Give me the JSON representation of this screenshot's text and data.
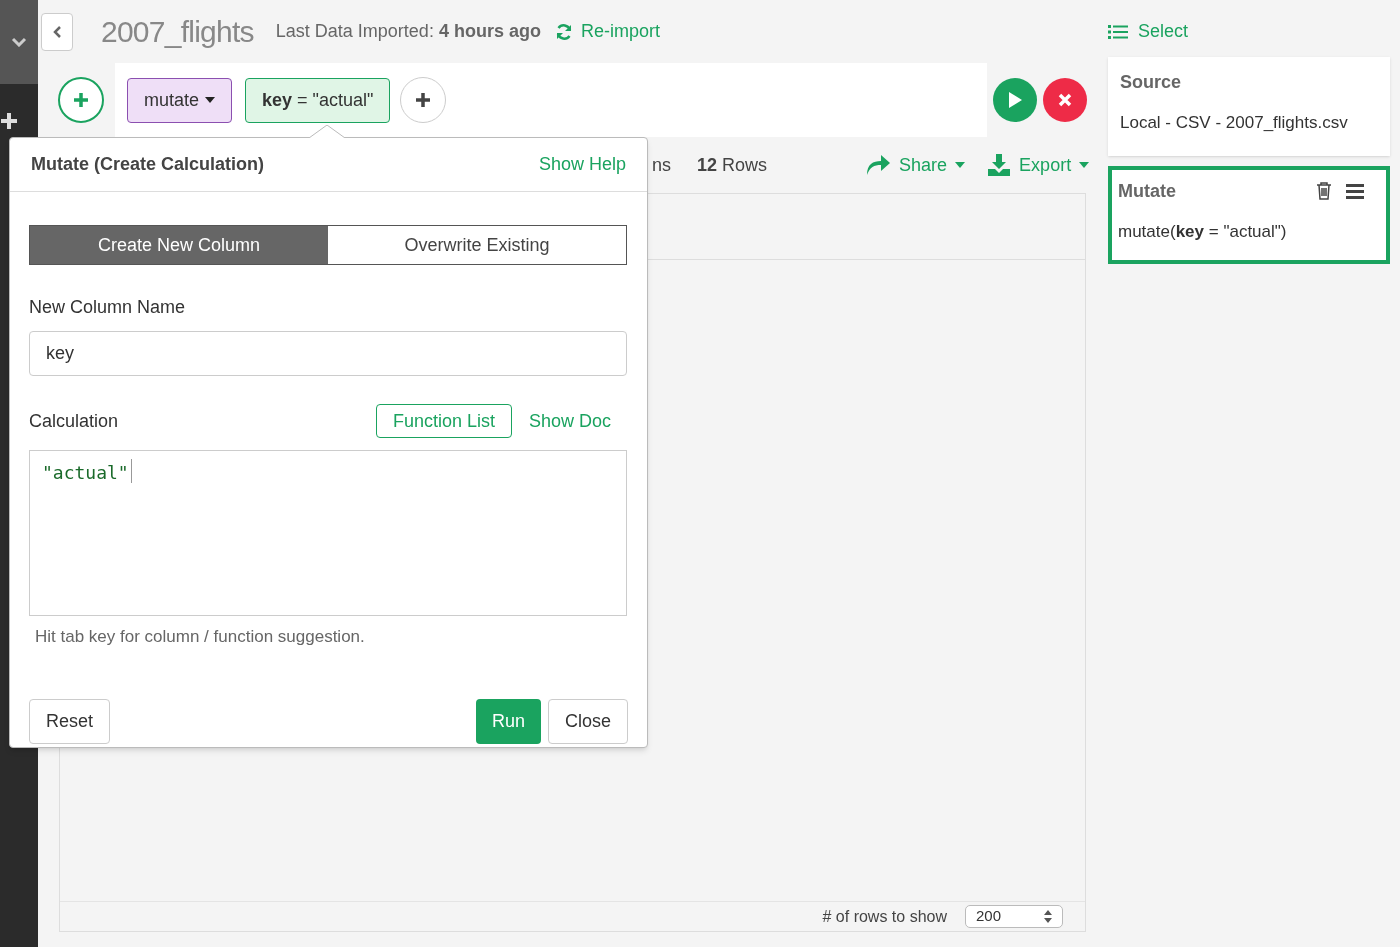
{
  "header": {
    "title": "2007_flights",
    "import_label": "Last Data Imported:",
    "import_time": "4 hours ago",
    "reimport": "Re-import"
  },
  "pipeline": {
    "command": "mutate",
    "step": "**key** = \"actual\""
  },
  "toolbar": {
    "columns_fragment": "ns",
    "rows": "**12** Rows",
    "share": "Share",
    "export": "Export"
  },
  "table_footer": {
    "rows_label": "# of rows to show",
    "rows_value": "200"
  },
  "steps_panel": {
    "select": "Select",
    "steps": [
      {
        "title": "Source",
        "body": "Local - CSV - 2007_flights.csv",
        "selected": false
      },
      {
        "title": "Mutate",
        "body": "mutate(**key** = \"actual\")",
        "selected": true
      }
    ]
  },
  "dialog": {
    "title": "Mutate (Create Calculation)",
    "show_help": "Show Help",
    "tabs": [
      {
        "label": "Create New Column",
        "selected": true
      },
      {
        "label": "Overwrite Existing",
        "selected": false
      }
    ],
    "name_label": "New Column Name",
    "name_value": "key",
    "calc_label": "Calculation",
    "function_list": "Function List",
    "show_doc": "Show Doc",
    "code": "\"actual\"",
    "hint": "Hit tab key for column / function suggestion.",
    "reset": "Reset",
    "run": "Run",
    "close": "Close"
  }
}
